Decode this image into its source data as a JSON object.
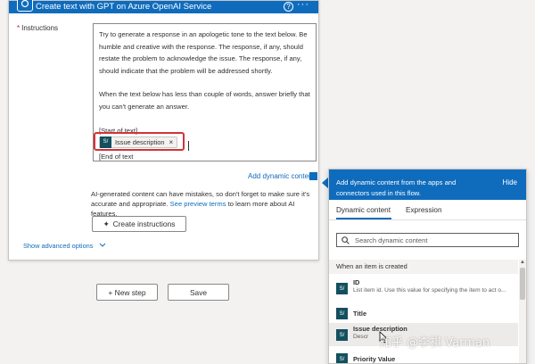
{
  "card": {
    "title": "Create text with GPT on Azure OpenAI Service",
    "help_glyph": "?",
    "more_glyph": "···",
    "instructions_required_mark": "*",
    "instructions_label": "Instructions",
    "instructions_para1": "Try to generate a response in an apologetic tone to the text below. Be humble and creative with the response. The response, if any, should restate the problem to acknowledge the issue. The response, if any, should indicate that the problem will be addressed shortly.",
    "instructions_para2": "When the text below has less than couple of words, answer briefly that you can't generate an answer.",
    "start_text": "[Start of text]",
    "token_label": "Issue description",
    "token_icon_text": "S/",
    "token_remove": "×",
    "end_text": "[End of text",
    "add_dynamic_content": "Add dynamic content",
    "disclaimer_text": "AI-generated content can have mistakes, so don't forget to make sure it's accurate and appropriate.",
    "disclaimer_link": "See preview terms",
    "disclaimer_tail": "to learn more about AI features.",
    "create_button": "Create instructions",
    "create_button_glyph": "✦",
    "show_advanced": "Show advanced options"
  },
  "actions": {
    "new_step": "+ New step",
    "save": "Save"
  },
  "flyout": {
    "header_text": "Add dynamic content from the apps and connectors used in this flow.",
    "hide": "Hide",
    "tabs": [
      "Dynamic content",
      "Expression"
    ],
    "search_placeholder": "Search dynamic content",
    "section": "When an item is created",
    "items": [
      {
        "title": "ID",
        "desc": "List item id. Use this value for specifying the item to act o..."
      },
      {
        "title": "Title",
        "desc": ""
      },
      {
        "title": "Issue description",
        "desc": "Descr"
      },
      {
        "title": "Priority Value",
        "desc": ""
      }
    ],
    "item_icon_text": "S/"
  },
  "watermark": "知乎 @李祺 Varman",
  "colors": {
    "accent": "#0f6cbd",
    "highlight_border": "#d13438",
    "connector_icon": "#13505f"
  }
}
